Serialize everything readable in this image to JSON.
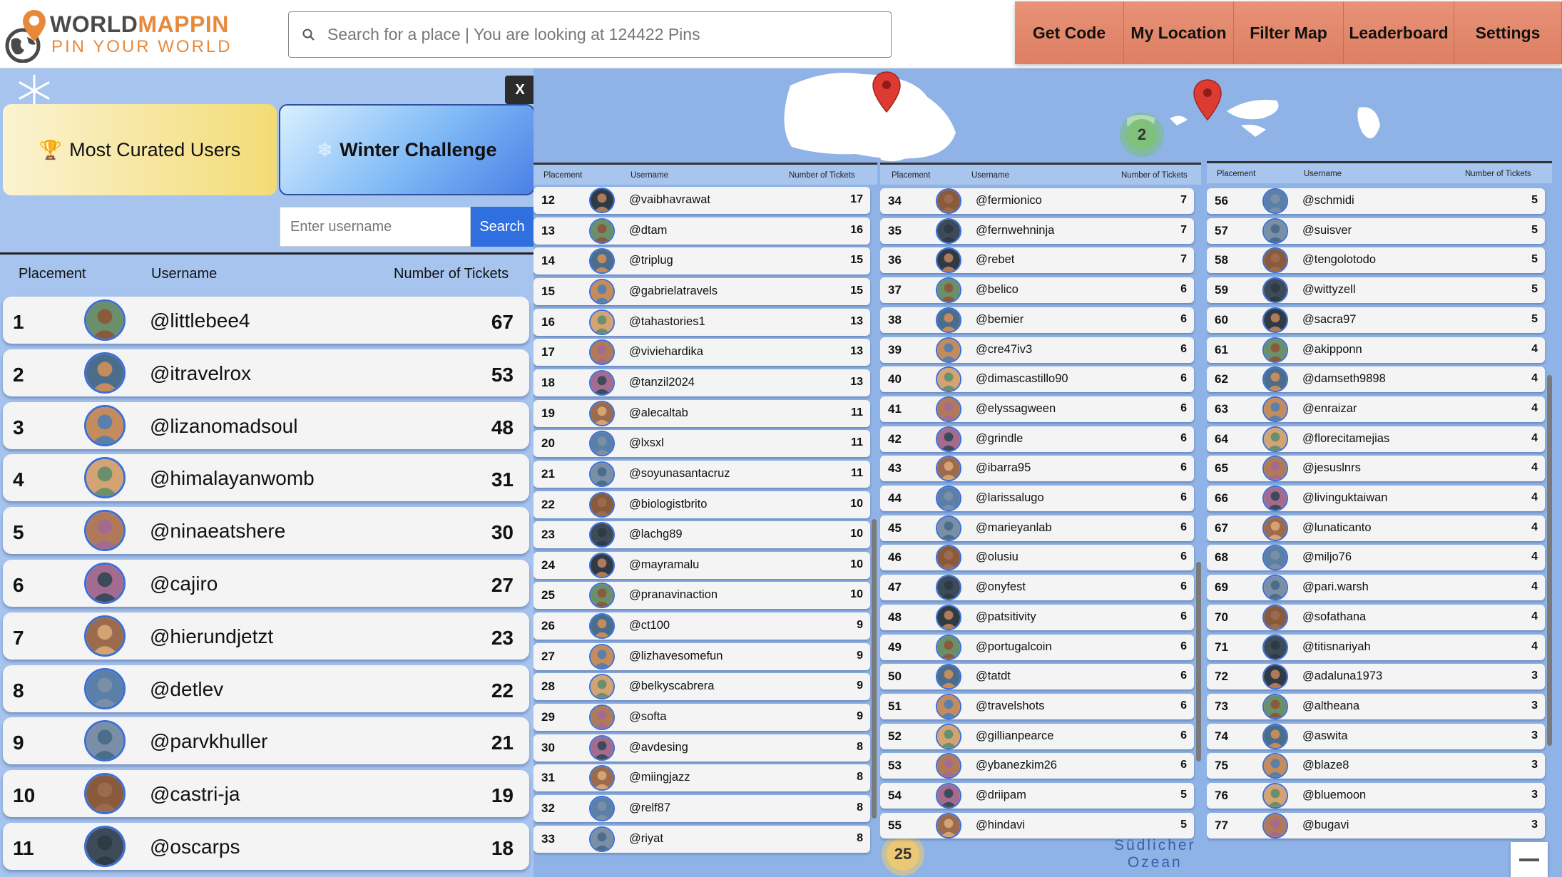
{
  "header": {
    "logo_word_a": "WORLD",
    "logo_word_b": "MAPPIN",
    "logo_tagline": "PIN YOUR WORLD",
    "search_placeholder": "Search for a place | You are looking at 124422 Pins",
    "nav": [
      "Get Code",
      "My Location",
      "Filter Map",
      "Leaderboard",
      "Settings"
    ]
  },
  "colors": {
    "accent": "#e8893a",
    "nav_bg": "#e0866a",
    "panel_bg": "#a6c4ee",
    "ocean": "#8fb3e6",
    "search_button": "#2f6fe0"
  },
  "map": {
    "clusters": [
      "2",
      "25"
    ],
    "ocean_label_line1": "Südlicher",
    "ocean_label_line2": "Ozean"
  },
  "panel": {
    "close_label": "X",
    "tabs": [
      {
        "icon": "🏆",
        "label": "Most Curated Users"
      },
      {
        "icon": "❄",
        "label": "Winter Challenge"
      }
    ],
    "username_placeholder": "Enter username",
    "search_label": "Search",
    "columns": {
      "placement": "Placement",
      "username": "Username",
      "tickets": "Number of Tickets"
    }
  },
  "leaderboard": [
    {
      "placement": "1",
      "username": "@littlebee4",
      "tickets": "67"
    },
    {
      "placement": "2",
      "username": "@itravelrox",
      "tickets": "53"
    },
    {
      "placement": "3",
      "username": "@lizanomadsoul",
      "tickets": "48"
    },
    {
      "placement": "4",
      "username": "@himalayanwomb",
      "tickets": "31"
    },
    {
      "placement": "5",
      "username": "@ninaeatshere",
      "tickets": "30"
    },
    {
      "placement": "6",
      "username": "@cajiro",
      "tickets": "27"
    },
    {
      "placement": "7",
      "username": "@hierundjetzt",
      "tickets": "23"
    },
    {
      "placement": "8",
      "username": "@detlev",
      "tickets": "22"
    },
    {
      "placement": "9",
      "username": "@parvkhuller",
      "tickets": "21"
    },
    {
      "placement": "10",
      "username": "@castri-ja",
      "tickets": "19"
    },
    {
      "placement": "11",
      "username": "@oscarps",
      "tickets": "18"
    },
    {
      "placement": "12",
      "username": "@vaibhavrawat",
      "tickets": "17"
    },
    {
      "placement": "13",
      "username": "@dtam",
      "tickets": "16"
    },
    {
      "placement": "14",
      "username": "@triplug",
      "tickets": "15"
    },
    {
      "placement": "15",
      "username": "@gabrielatravels",
      "tickets": "15"
    },
    {
      "placement": "16",
      "username": "@tahastories1",
      "tickets": "13"
    },
    {
      "placement": "17",
      "username": "@viviehardika",
      "tickets": "13"
    },
    {
      "placement": "18",
      "username": "@tanzil2024",
      "tickets": "13"
    },
    {
      "placement": "19",
      "username": "@alecaltab",
      "tickets": "11"
    },
    {
      "placement": "20",
      "username": "@lxsxl",
      "tickets": "11"
    },
    {
      "placement": "21",
      "username": "@soyunasantacruz",
      "tickets": "11"
    },
    {
      "placement": "22",
      "username": "@biologistbrito",
      "tickets": "10"
    },
    {
      "placement": "23",
      "username": "@lachg89",
      "tickets": "10"
    },
    {
      "placement": "24",
      "username": "@mayramalu",
      "tickets": "10"
    },
    {
      "placement": "25",
      "username": "@pranavinaction",
      "tickets": "10"
    },
    {
      "placement": "26",
      "username": "@ct100",
      "tickets": "9"
    },
    {
      "placement": "27",
      "username": "@lizhavesomefun",
      "tickets": "9"
    },
    {
      "placement": "28",
      "username": "@belkyscabrera",
      "tickets": "9"
    },
    {
      "placement": "29",
      "username": "@softa",
      "tickets": "9"
    },
    {
      "placement": "30",
      "username": "@avdesing",
      "tickets": "8"
    },
    {
      "placement": "31",
      "username": "@miingjazz",
      "tickets": "8"
    },
    {
      "placement": "32",
      "username": "@relf87",
      "tickets": "8"
    },
    {
      "placement": "33",
      "username": "@riyat",
      "tickets": "8"
    },
    {
      "placement": "34",
      "username": "@fermionico",
      "tickets": "7"
    },
    {
      "placement": "35",
      "username": "@fernwehninja",
      "tickets": "7"
    },
    {
      "placement": "36",
      "username": "@rebet",
      "tickets": "7"
    },
    {
      "placement": "37",
      "username": "@belico",
      "tickets": "6"
    },
    {
      "placement": "38",
      "username": "@bemier",
      "tickets": "6"
    },
    {
      "placement": "39",
      "username": "@cre47iv3",
      "tickets": "6"
    },
    {
      "placement": "40",
      "username": "@dimascastillo90",
      "tickets": "6"
    },
    {
      "placement": "41",
      "username": "@elyssagween",
      "tickets": "6"
    },
    {
      "placement": "42",
      "username": "@grindle",
      "tickets": "6"
    },
    {
      "placement": "43",
      "username": "@ibarra95",
      "tickets": "6"
    },
    {
      "placement": "44",
      "username": "@larissalugo",
      "tickets": "6"
    },
    {
      "placement": "45",
      "username": "@marieyanlab",
      "tickets": "6"
    },
    {
      "placement": "46",
      "username": "@olusiu",
      "tickets": "6"
    },
    {
      "placement": "47",
      "username": "@onyfest",
      "tickets": "6"
    },
    {
      "placement": "48",
      "username": "@patsitivity",
      "tickets": "6"
    },
    {
      "placement": "49",
      "username": "@portugalcoin",
      "tickets": "6"
    },
    {
      "placement": "50",
      "username": "@tatdt",
      "tickets": "6"
    },
    {
      "placement": "51",
      "username": "@travelshots",
      "tickets": "6"
    },
    {
      "placement": "52",
      "username": "@gillianpearce",
      "tickets": "6"
    },
    {
      "placement": "53",
      "username": "@ybanezkim26",
      "tickets": "6"
    },
    {
      "placement": "54",
      "username": "@driipam",
      "tickets": "5"
    },
    {
      "placement": "55",
      "username": "@hindavi",
      "tickets": "5"
    },
    {
      "placement": "56",
      "username": "@schmidi",
      "tickets": "5"
    },
    {
      "placement": "57",
      "username": "@suisver",
      "tickets": "5"
    },
    {
      "placement": "58",
      "username": "@tengolotodo",
      "tickets": "5"
    },
    {
      "placement": "59",
      "username": "@wittyzell",
      "tickets": "5"
    },
    {
      "placement": "60",
      "username": "@sacra97",
      "tickets": "5"
    },
    {
      "placement": "61",
      "username": "@akipponn",
      "tickets": "4"
    },
    {
      "placement": "62",
      "username": "@damseth9898",
      "tickets": "4"
    },
    {
      "placement": "63",
      "username": "@enraizar",
      "tickets": "4"
    },
    {
      "placement": "64",
      "username": "@florecitamejias",
      "tickets": "4"
    },
    {
      "placement": "65",
      "username": "@jesuslnrs",
      "tickets": "4"
    },
    {
      "placement": "66",
      "username": "@livinguktaiwan",
      "tickets": "4"
    },
    {
      "placement": "67",
      "username": "@lunaticanto",
      "tickets": "4"
    },
    {
      "placement": "68",
      "username": "@miljo76",
      "tickets": "4"
    },
    {
      "placement": "69",
      "username": "@pari.warsh",
      "tickets": "4"
    },
    {
      "placement": "70",
      "username": "@sofathana",
      "tickets": "4"
    },
    {
      "placement": "71",
      "username": "@titisnariyah",
      "tickets": "4"
    },
    {
      "placement": "72",
      "username": "@adaluna1973",
      "tickets": "3"
    },
    {
      "placement": "73",
      "username": "@altheana",
      "tickets": "3"
    },
    {
      "placement": "74",
      "username": "@aswita",
      "tickets": "3"
    },
    {
      "placement": "75",
      "username": "@blaze8",
      "tickets": "3"
    },
    {
      "placement": "76",
      "username": "@bluemoon",
      "tickets": "3"
    },
    {
      "placement": "77",
      "username": "@bugavi",
      "tickets": "3"
    }
  ]
}
